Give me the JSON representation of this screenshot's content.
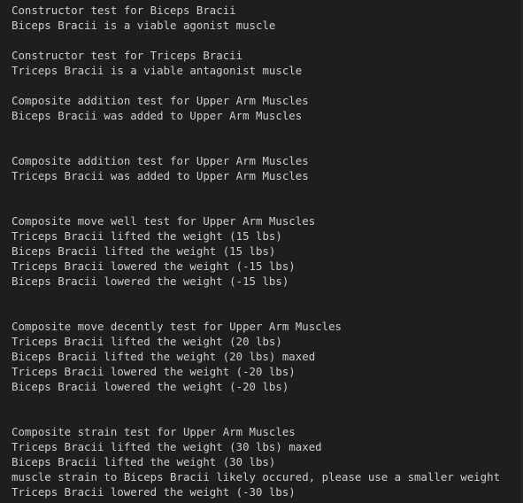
{
  "output": {
    "lines": [
      "Constructor test for Biceps Bracii",
      "Biceps Bracii is a viable agonist muscle",
      "",
      "Constructor test for Triceps Bracii",
      "Triceps Bracii is a viable antagonist muscle",
      "",
      "Composite addition test for Upper Arm Muscles",
      "Biceps Bracii was added to Upper Arm Muscles",
      "",
      "",
      "Composite addition test for Upper Arm Muscles",
      "Triceps Bracii was added to Upper Arm Muscles",
      "",
      "",
      "Composite move well test for Upper Arm Muscles",
      "Triceps Bracii lifted the weight (15 lbs)",
      "Biceps Bracii lifted the weight (15 lbs)",
      "Triceps Bracii lowered the weight (-15 lbs)",
      "Biceps Bracii lowered the weight (-15 lbs)",
      "",
      "",
      "Composite move decently test for Upper Arm Muscles",
      "Triceps Bracii lifted the weight (20 lbs)",
      "Biceps Bracii lifted the weight (20 lbs) maxed",
      "Triceps Bracii lowered the weight (-20 lbs)",
      "Biceps Bracii lowered the weight (-20 lbs)",
      "",
      "",
      "Composite strain test for Upper Arm Muscles",
      "Triceps Bracii lifted the weight (30 lbs) maxed",
      "Biceps Bracii lifted the weight (30 lbs)",
      "muscle strain to Biceps Bracii likely occured, please use a smaller weight",
      "Triceps Bracii lowered the weight (-30 lbs)"
    ]
  },
  "colors": {
    "background": "#1e1e1e",
    "text": "#cccccc"
  }
}
